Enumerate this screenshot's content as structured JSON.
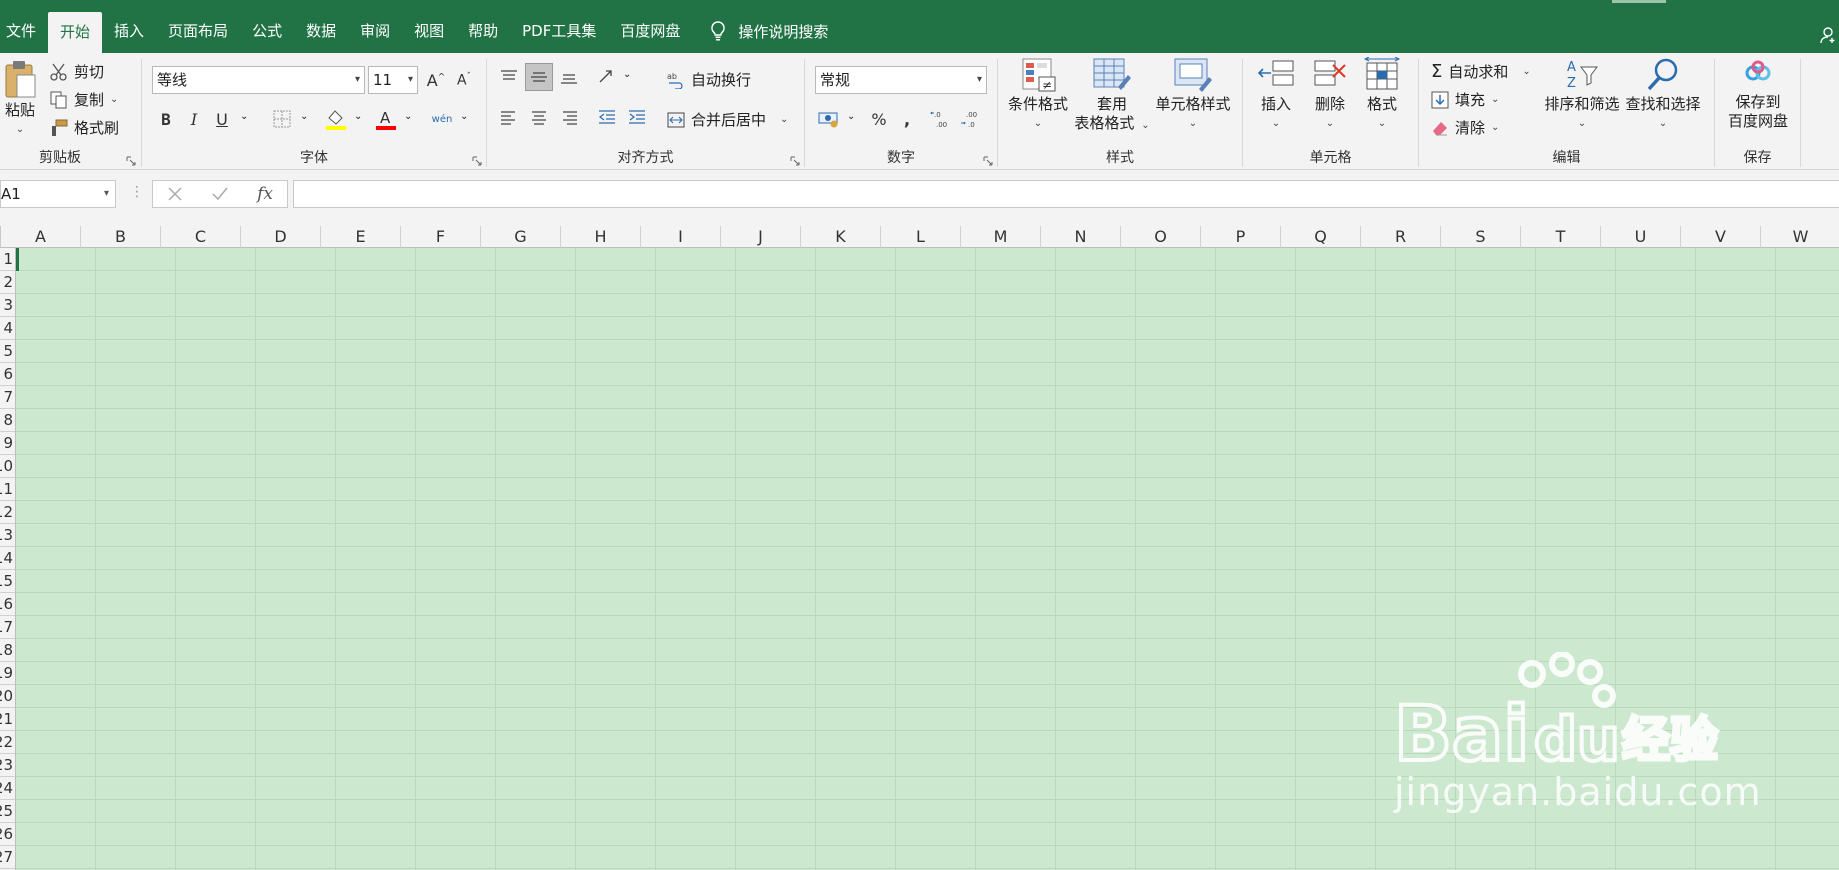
{
  "tabs": [
    {
      "label": "文件",
      "active": false
    },
    {
      "label": "开始",
      "active": true
    },
    {
      "label": "插入",
      "active": false
    },
    {
      "label": "页面布局",
      "active": false
    },
    {
      "label": "公式",
      "active": false
    },
    {
      "label": "数据",
      "active": false
    },
    {
      "label": "审阅",
      "active": false
    },
    {
      "label": "视图",
      "active": false
    },
    {
      "label": "帮助",
      "active": false
    },
    {
      "label": "PDF工具集",
      "active": false
    },
    {
      "label": "百度网盘",
      "active": false
    }
  ],
  "tell_me": "操作说明搜索",
  "colors": {
    "accent": "#217346",
    "sheet_bg": "#cce8cf",
    "ribbon_bg": "#f3f3f3"
  },
  "clipboard": {
    "label": "剪贴板",
    "paste": "粘贴",
    "cut": "剪切",
    "copy": "复制",
    "format_painter": "格式刷"
  },
  "font": {
    "label": "字体",
    "name": "等线",
    "size": "11",
    "bold": "B",
    "italic": "I",
    "underline": "U",
    "phonetic": "wén"
  },
  "alignment": {
    "label": "对齐方式",
    "wrap_text": "自动换行",
    "merge_center": "合并后居中"
  },
  "number": {
    "label": "数字",
    "format": "常规",
    "percent": "%",
    "comma": ","
  },
  "styles": {
    "label": "样式",
    "conditional_formatting": "条件格式",
    "format_as_table_1": "套用",
    "format_as_table_2": "表格格式",
    "cell_styles": "单元格样式"
  },
  "cells": {
    "label": "单元格",
    "insert": "插入",
    "delete": "删除",
    "format": "格式"
  },
  "editing": {
    "label": "编辑",
    "autosum": "自动求和",
    "fill": "填充",
    "clear": "清除",
    "sort_filter": "排序和筛选",
    "find_select": "查找和选择"
  },
  "save": {
    "label": "保存",
    "save_to_1": "保存到",
    "save_to_2": "百度网盘"
  },
  "formula_bar": {
    "name_box": "A1",
    "fx": "fx",
    "formula": ""
  },
  "columns": [
    "A",
    "B",
    "C",
    "D",
    "E",
    "F",
    "G",
    "H",
    "I",
    "J",
    "K",
    "L",
    "M",
    "N",
    "O",
    "P",
    "Q",
    "R",
    "S",
    "T",
    "U",
    "V",
    "W"
  ],
  "rows": [
    "1",
    "2",
    "3",
    "4",
    "5",
    "6",
    "7",
    "8",
    "9",
    "10",
    "11",
    "12",
    "13",
    "14",
    "15",
    "16",
    "17",
    "18",
    "19",
    "20",
    "21",
    "22",
    "23",
    "24",
    "25",
    "26",
    "27"
  ],
  "watermark": {
    "url": "jingyan.baidu.com",
    "logo_text": "Bai du 经验"
  }
}
